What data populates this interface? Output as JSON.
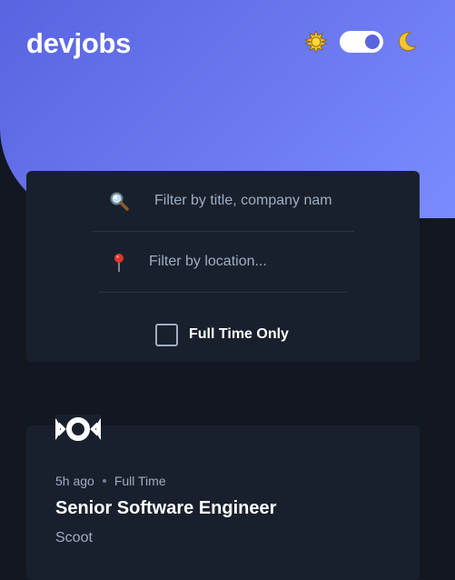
{
  "app": {
    "logo": "devjobs"
  },
  "theme": {
    "sun_icon": "sun-icon",
    "moon_icon": "moon-icon",
    "dark_mode": true
  },
  "search": {
    "title_placeholder": "Filter by title, company nam",
    "location_placeholder": "Filter by location...",
    "full_time_label": "Full Time Only",
    "full_time_checked": false,
    "search_icon": "magnifier-icon",
    "location_icon": "pin-icon"
  },
  "jobs": [
    {
      "posted": "5h ago",
      "contract": "Full Time",
      "title": "Senior Software Engineer",
      "company": "Scoot",
      "logo_icon": "scoot-logo"
    }
  ],
  "colors": {
    "accent": "#5964E0",
    "background": "#121721",
    "card": "#19202D",
    "muted_text": "#9DAEC2"
  }
}
